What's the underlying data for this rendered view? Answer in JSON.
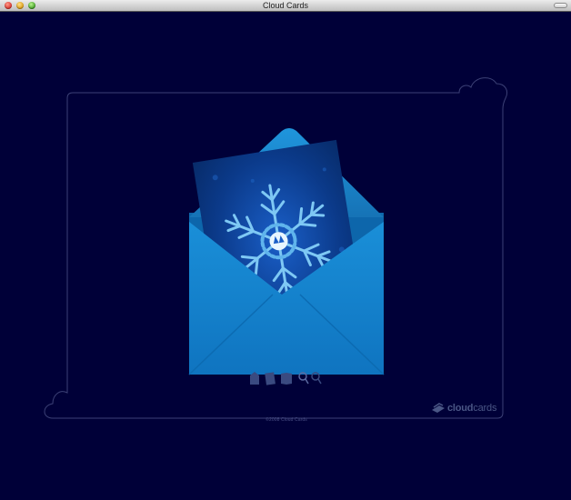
{
  "window": {
    "title": "Cloud Cards"
  },
  "toolbar": {
    "tools": [
      {
        "icon": "card-front-icon"
      },
      {
        "icon": "card-flip-icon"
      },
      {
        "icon": "card-open-icon"
      },
      {
        "icon": "zoom-in-icon"
      },
      {
        "icon": "zoom-out-icon"
      }
    ]
  },
  "footer": {
    "copyright": "©2008 Cloud Cards",
    "brand_bold": "cloud",
    "brand_light": "cards"
  },
  "colors": {
    "background": "#000038",
    "frame_stroke": "#3c4176",
    "envelope": "#1a88d0",
    "card": "#0b3d8e",
    "snowflake": "#7ec8f4"
  }
}
